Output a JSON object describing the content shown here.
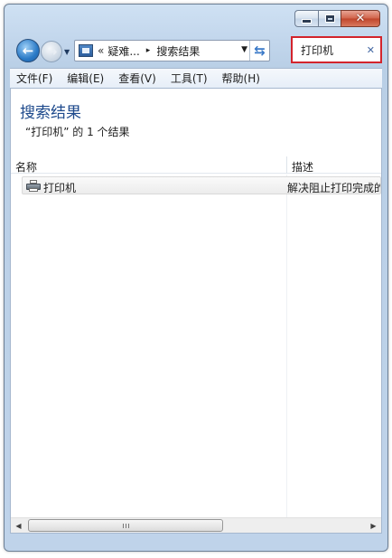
{
  "window": {
    "caption": {
      "minimize_icon": "minimize-icon",
      "maximize_icon": "maximize-icon",
      "close_glyph": "✕"
    }
  },
  "nav": {
    "back_glyph": "←",
    "forward_glyph": "→",
    "recent_glyph": "▼",
    "address": {
      "chevrons": "«",
      "segments": [
        "疑难...",
        "搜索结果"
      ],
      "separator": "▸",
      "dropdown_glyph": "▼",
      "refresh_glyph": "⇆"
    },
    "search": {
      "value": "打印机",
      "clear_glyph": "✕",
      "highlight_color": "#d3242c"
    }
  },
  "menu": {
    "items": [
      {
        "label": "文件(F)"
      },
      {
        "label": "编辑(E)"
      },
      {
        "label": "查看(V)"
      },
      {
        "label": "工具(T)"
      },
      {
        "label": "帮助(H)"
      }
    ]
  },
  "results": {
    "title": "搜索结果",
    "count_text": "“打印机” 的 1 个结果",
    "columns": {
      "name": "名称",
      "description": "描述"
    },
    "rows": [
      {
        "icon": "printer-icon",
        "name": "打印机",
        "description": "解决阻止打印完成的"
      }
    ]
  },
  "scrollbar": {
    "left_glyph": "◀",
    "right_glyph": "▶"
  },
  "colors": {
    "title_blue": "#1e4a8c",
    "frame": "#bfd3ea"
  }
}
